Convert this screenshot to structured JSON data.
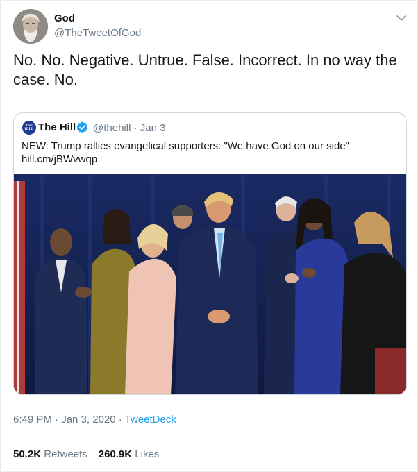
{
  "tweet": {
    "author_name": "God",
    "author_handle": "@TheTweetOfGod",
    "text": "No. No. Negative. Untrue. False. Incorrect. In no way the case. No.",
    "timestamp": "6:49 PM · Jan 3, 2020",
    "source_separator": " · ",
    "source": "TweetDeck",
    "retweets_count": "50.2K",
    "retweets_label": "Retweets",
    "likes_count": "260.9K",
    "likes_label": "Likes"
  },
  "quoted": {
    "avatar_text": "THE HILL",
    "author_name": "The Hill",
    "author_handle": "@thehill",
    "date": "· Jan 3",
    "text_line1": "NEW: Trump rallies evangelical supporters: \"We have God on our side\"",
    "text_line2": "hill.cm/jBWvwqp",
    "verified": true
  },
  "colors": {
    "link": "#1da1f2",
    "secondary_text": "#657786",
    "verified": "#1da1f2"
  },
  "icons": [
    "chevron-down-icon",
    "verified-badge-icon"
  ]
}
